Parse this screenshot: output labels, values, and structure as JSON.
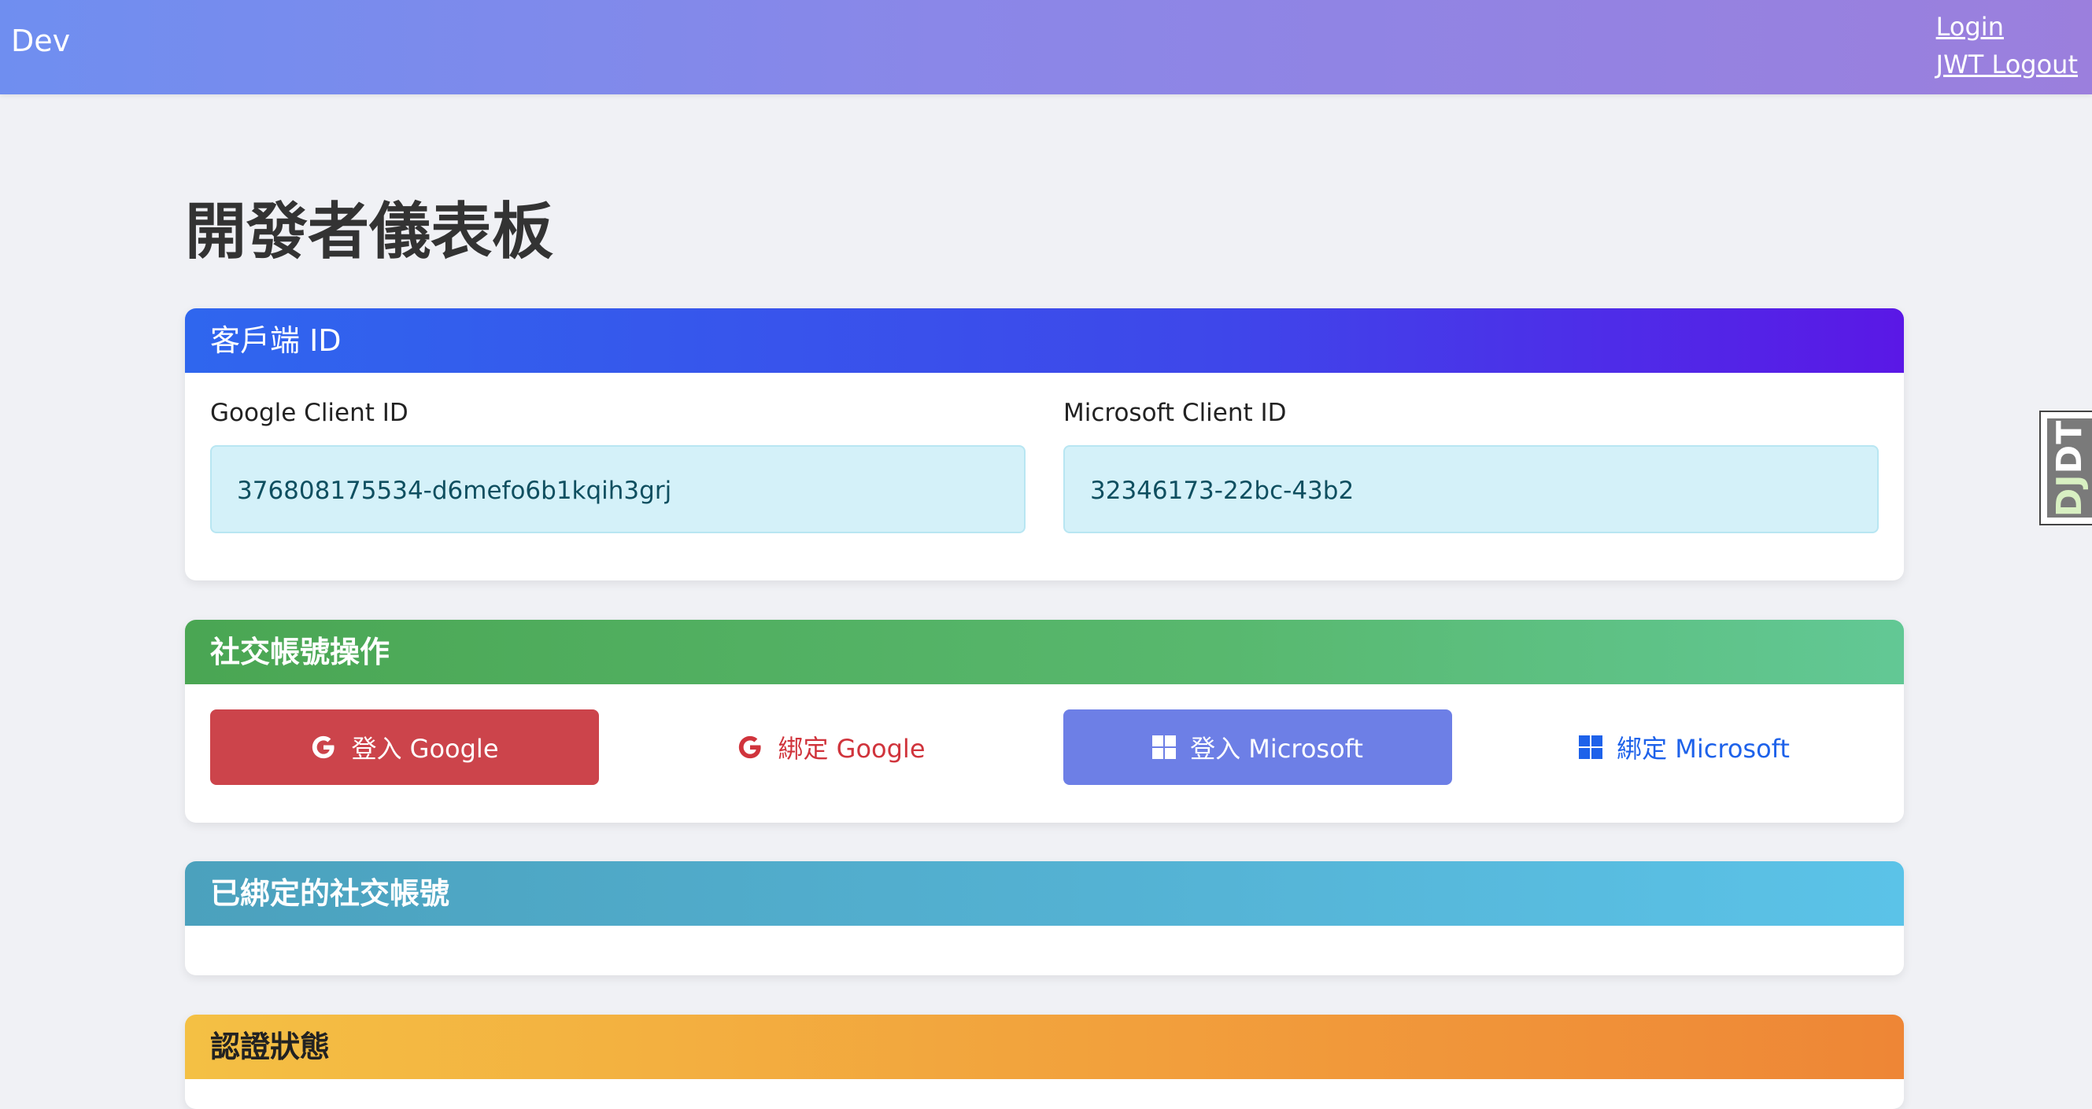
{
  "navbar": {
    "brand": "Dev",
    "links": [
      "Login",
      "JWT Logout"
    ]
  },
  "page": {
    "title": "開發者儀表板"
  },
  "client_ids": {
    "header": "客戶端 ID",
    "google_label": "Google Client ID",
    "google_value": "376808175534-d6mefo6b1kqih3grj",
    "microsoft_label": "Microsoft Client ID",
    "microsoft_value": "32346173-22bc-43b2"
  },
  "social_actions": {
    "header": "社交帳號操作",
    "google_login": "登入 Google",
    "google_bind": "綁定 Google",
    "microsoft_login": "登入 Microsoft",
    "microsoft_bind": "綁定 Microsoft",
    "icons": {
      "google": "google-g-icon",
      "microsoft": "windows-logo-icon"
    }
  },
  "bound_accounts": {
    "header": "已綁定的社交帳號"
  },
  "auth_status": {
    "header": "認證狀態"
  },
  "debug_toolbar": {
    "label_dj": "DJ",
    "label_dt": "DT"
  },
  "colors": {
    "navbar_start": "#6f8ef0",
    "navbar_end": "#9b7fdd",
    "client_header": "#3e47ea",
    "social_header": "#58b86e",
    "bound_header": "#55b4d6",
    "auth_header": "#f2a03c",
    "google_login_bg": "#cc444b",
    "ms_login_bg": "#6d7fe6",
    "ms_bind_text": "#1e62ea",
    "google_bind_text": "#d0343c"
  }
}
